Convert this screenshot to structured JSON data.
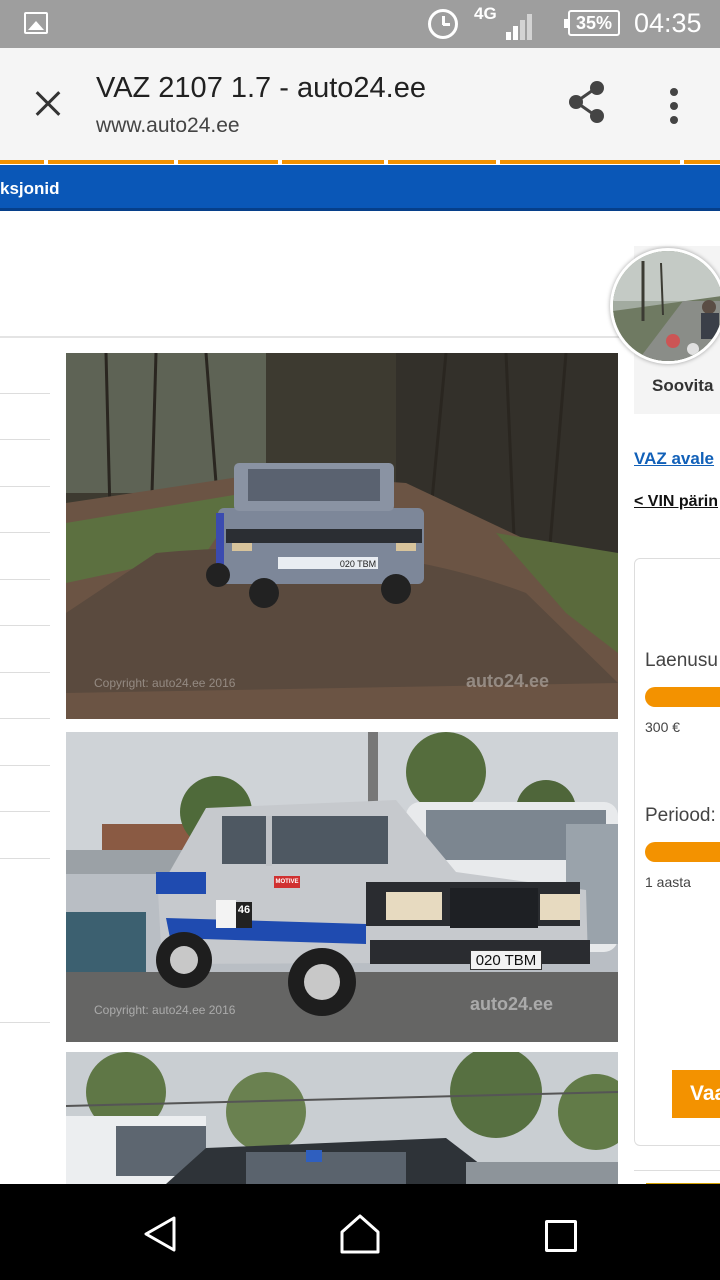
{
  "status_bar": {
    "network": "4G",
    "battery": "35%",
    "time": "04:35",
    "icons": [
      "image-notification-icon",
      "alarm-icon",
      "signal-icon",
      "battery-icon"
    ]
  },
  "toolbar": {
    "title": "VAZ 2107 1.7 - auto24.ee",
    "url": "www.auto24.ee",
    "icons": [
      "close-icon",
      "share-icon",
      "more-vert-icon"
    ]
  },
  "page": {
    "nav_text": "ksjonid",
    "sidebar": {
      "soovita_label": "Soovita",
      "vaz_link": "VAZ avale",
      "vin_link": "< VIN pärin"
    },
    "photos": [
      {
        "watermark": "Copyright: auto24.ee 2016",
        "logo": "auto24.ee",
        "plate": "020 TBM"
      },
      {
        "watermark": "Copyright: auto24.ee 2016",
        "logo": "auto24.ee",
        "plate": "020 TBM",
        "race_number": "46",
        "sticker": "MOTIVE"
      },
      {
        "watermark": "",
        "logo": "",
        "plate": ""
      }
    ],
    "loan_calculator": {
      "loan_label": "Laenusu",
      "loan_value": "300 €",
      "period_label": "Periood:",
      "period_value": "1 aasta",
      "button_label": "Vaa"
    }
  },
  "colors": {
    "accent_orange": "#f39200",
    "nav_blue": "#0a57b7",
    "link_blue": "#1160b8",
    "status_bar": "#9e9e9e",
    "toolbar_bg": "#f5f5f5"
  }
}
